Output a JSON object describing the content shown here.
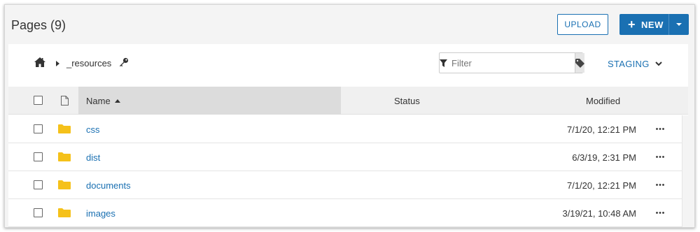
{
  "header": {
    "title": "Pages (9)",
    "upload_label": "UPLOAD",
    "new_plus": "+",
    "new_label": "NEW"
  },
  "breadcrumb": {
    "icons": [
      "home-icon",
      "chevron-right-icon",
      "key-icon"
    ],
    "current": "_resources"
  },
  "filter": {
    "placeholder": "Filter",
    "icons": [
      "filter-icon",
      "tag-icon"
    ]
  },
  "environment": {
    "label": "STAGING",
    "icon": "chevron-down-icon"
  },
  "table": {
    "columns": {
      "name": "Name",
      "status": "Status",
      "modified": "Modified"
    },
    "sort": {
      "column": "Name",
      "direction": "ascending"
    },
    "rows": [
      {
        "name": "css",
        "status": "",
        "modified": "7/1/20, 12:21 PM"
      },
      {
        "name": "dist",
        "status": "",
        "modified": "6/3/19, 2:31 PM"
      },
      {
        "name": "documents",
        "status": "",
        "modified": "7/1/20, 12:21 PM"
      },
      {
        "name": "images",
        "status": "",
        "modified": "3/19/21, 10:48 AM"
      }
    ]
  },
  "colors": {
    "accent": "#1a70b2",
    "folder": "#f5c11a",
    "header_bg": "#f0f0f0",
    "sorted_column_bg": "#dcdcdc"
  }
}
